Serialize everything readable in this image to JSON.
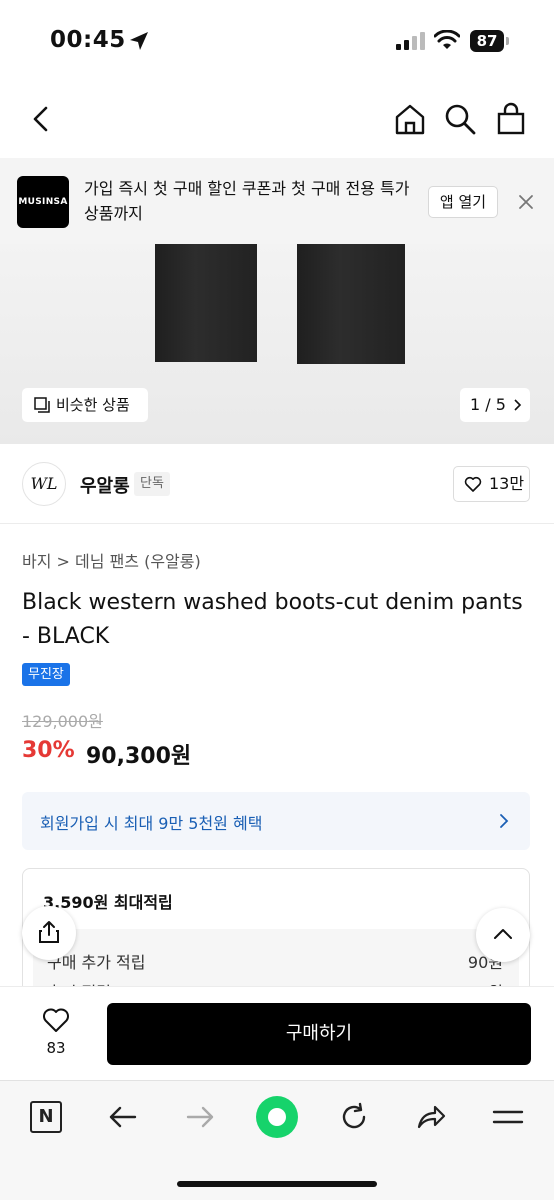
{
  "status_bar": {
    "time": "00:45",
    "battery": "87"
  },
  "header": {
    "icons": [
      "back-icon",
      "home-icon",
      "search-icon",
      "shopping-bag-icon"
    ]
  },
  "app_banner": {
    "logo": "MUSINSA",
    "text": "가입 즉시 첫 구매 할인 쿠폰과 첫 구매 전용 특가 상품까지",
    "open_label": "앱 열기"
  },
  "gallery": {
    "similar_label": "비슷한 상품",
    "pager": "1 / 5"
  },
  "brand": {
    "logo": "WL",
    "name": "우알롱",
    "tag": "단독",
    "likes": "13만"
  },
  "product": {
    "breadcrumb": [
      "바지",
      "데님 팬츠 (우알롱)"
    ],
    "title": "Black western washed boots-cut denim pants - BLACK",
    "badge": "무진장",
    "original_price": "129,000원",
    "discount": "30%",
    "price": "90,300원"
  },
  "member_benefit": {
    "text": "회원가입 시 최대 9만 5천원 혜택"
  },
  "points": {
    "title": "3,590원 최대적립",
    "rows": [
      {
        "label": "구매 추가 적립",
        "value": "90원"
      },
      {
        "label": "후기 적립",
        "value": "3,500원"
      }
    ]
  },
  "purchase_bar": {
    "wish_count": "83",
    "buy_label": "구매하기"
  },
  "browser_toolbar": {
    "n_label": "N",
    "icons": [
      "n-icon",
      "back-arrow-icon",
      "forward-arrow-icon",
      "green-home-icon",
      "refresh-icon",
      "share-icon",
      "menu-icon"
    ],
    "accent": "#16d36b"
  }
}
